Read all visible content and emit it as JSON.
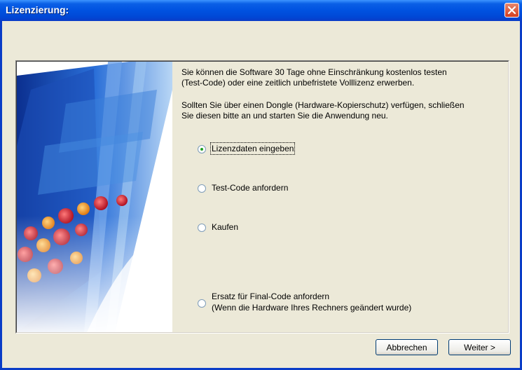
{
  "window": {
    "title": "Lizenzierung:"
  },
  "intro": {
    "para1_line1": "Sie können die Software 30 Tage ohne Einschränkung kostenlos testen",
    "para1_line2": "(Test-Code) oder eine zeitlich unbefristete Volllizenz erwerben.",
    "para2_line1": "Sollten Sie über einen Dongle (Hardware-Kopierschutz) verfügen, schließen",
    "para2_line2": "Sie diesen bitte an und starten Sie die Anwendung neu."
  },
  "options": [
    {
      "label": "Lizenzdaten eingeben",
      "checked": true
    },
    {
      "label": "Test-Code anfordern",
      "checked": false
    },
    {
      "label": "Kaufen",
      "checked": false
    },
    {
      "label": "Ersatz für Final-Code anfordern",
      "sublabel": "(Wenn die Hardware Ihres Rechners geändert wurde)",
      "checked": false
    }
  ],
  "buttons": {
    "cancel": "Abbrechen",
    "next": "Weiter >"
  },
  "icons": {
    "close": "close-icon"
  },
  "colors": {
    "titlebar": "#0052e0",
    "close": "#d33d1f",
    "radio_dot": "#21a121"
  }
}
